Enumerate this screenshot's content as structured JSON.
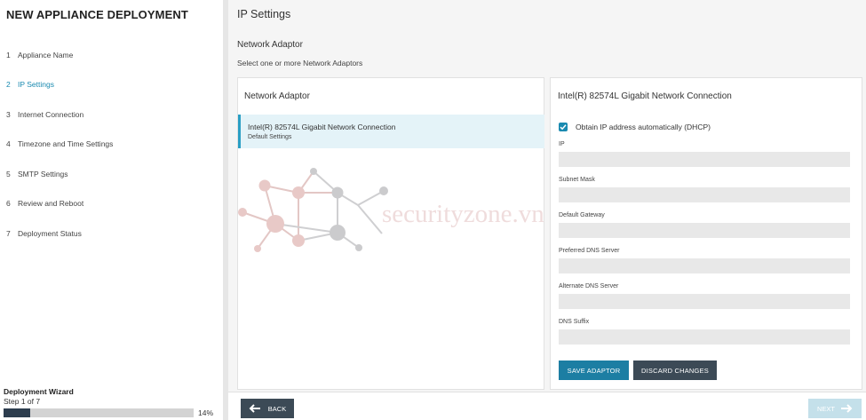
{
  "app": {
    "title": "NEW APPLIANCE DEPLOYMENT"
  },
  "steps": [
    {
      "num": "1",
      "label": "Appliance Name"
    },
    {
      "num": "2",
      "label": "IP Settings"
    },
    {
      "num": "3",
      "label": "Internet Connection"
    },
    {
      "num": "4",
      "label": "Timezone and Time Settings"
    },
    {
      "num": "5",
      "label": "SMTP Settings"
    },
    {
      "num": "6",
      "label": "Review and Reboot"
    },
    {
      "num": "7",
      "label": "Deployment Status"
    }
  ],
  "active_step": 2,
  "wizard": {
    "title": "Deployment Wizard",
    "step_text": "Step 1 of 7",
    "progress": 0.14,
    "progress_label": "14%"
  },
  "page": {
    "title": "IP Settings",
    "section_title": "Network Adaptor",
    "section_sub": "Select one or more Network Adaptors"
  },
  "left_panel": {
    "title": "Network Adaptor",
    "adaptor": {
      "name": "Intel(R) 82574L Gigabit Network Connection",
      "sub": "Default Settings"
    }
  },
  "watermark": {
    "text": "securityzone.vn"
  },
  "right_panel": {
    "title": "Intel(R) 82574L Gigabit Network Connection",
    "dhcp_label": "Obtain IP address automatically (DHCP)",
    "dhcp_checked": true,
    "fields": {
      "ip": {
        "label": "IP",
        "value": ""
      },
      "subnet": {
        "label": "Subnet Mask",
        "value": ""
      },
      "gateway": {
        "label": "Default Gateway",
        "value": ""
      },
      "dns1": {
        "label": "Preferred DNS Server",
        "value": ""
      },
      "dns2": {
        "label": "Alternate DNS Server",
        "value": ""
      },
      "suffix": {
        "label": "DNS Suffix",
        "value": ""
      }
    },
    "save_label": "SAVE ADAPTOR",
    "discard_label": "DISCARD CHANGES"
  },
  "footer": {
    "back_label": "BACK",
    "next_label": "NEXT"
  },
  "colors": {
    "accent": "#1a8ab0",
    "dark_button": "#3c4a56",
    "save_button": "#1c7ea3",
    "disabled_next": "#c4e0ea"
  }
}
